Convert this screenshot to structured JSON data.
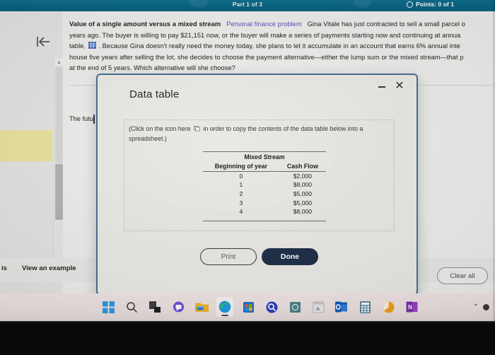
{
  "header": {
    "part_label": "Part 1 of 3",
    "points_text": "Points: 0 of 1",
    "points_icon": "circle-progress-icon",
    "bg_color": "#0a6585"
  },
  "problem": {
    "title": "Value of a single amount versus a mixed stream",
    "subtitle": "Personal finance problem",
    "body_1": "Gina Vitale has just contracted to sell a small parcel o",
    "body_2": "years ago.  The buyer is willing to pay $21,151 now, or the buyer will make  a series of payments starting now and continuing at annua",
    "body_3_pre": "table,",
    "body_3_post": ". Because Gina doesn't really need the money today, she plans to let it accumulate in an account that earns 6% annual inte",
    "body_4": "house five years after selling the lot, she decides to choose the payment alternative—either the lump sum or the mixed stream—that p",
    "body_5": "at the end of 5 years.  Which alternative will she choose?",
    "grid_icon": "data-table-grid-icon",
    "future_line": "The futu",
    "subtitle_color": "#5a4fc4"
  },
  "navigation": {
    "back_arrow_icon": "back-arrow-icon",
    "scrollbar_up_icon": "caret-up-icon",
    "scrollbar_down_icon": "caret-down-icon"
  },
  "action_bar": {
    "is_text": "is",
    "view_example_label": "View an example",
    "clear_all_label": "Clear all"
  },
  "dialog": {
    "title": "Data table",
    "minimize_icon": "minimize-icon",
    "close_icon": "close-icon",
    "hint_pre": "(Click on the icon here",
    "hint_post": "in order to copy the contents of the data table below into a spreadsheet.)",
    "copy_icon": "copy-to-spreadsheet-icon",
    "print_label": "Print",
    "done_label": "Done",
    "border_color": "#4b6f91",
    "done_bg": "#22304a"
  },
  "data_table": {
    "span_header": "Mixed Stream",
    "columns": [
      "Beginning of year",
      "Cash Flow"
    ],
    "rows": [
      [
        "0",
        "$2,000"
      ],
      [
        "1",
        "$8,000"
      ],
      [
        "2",
        "$5,000"
      ],
      [
        "3",
        "$5,000"
      ],
      [
        "4",
        "$8,000"
      ]
    ]
  },
  "taskbar": {
    "items": [
      {
        "name": "start-button-icon",
        "label": "Start"
      },
      {
        "name": "search-icon",
        "label": "Search"
      },
      {
        "name": "task-view-icon",
        "label": "Task View"
      },
      {
        "name": "chat-icon",
        "label": "Chat"
      },
      {
        "name": "file-explorer-icon",
        "label": "File Explorer"
      },
      {
        "name": "microsoft-edge-icon",
        "label": "Microsoft Edge"
      },
      {
        "name": "microsoft-store-icon",
        "label": "Microsoft Store"
      },
      {
        "name": "search-blue-icon",
        "label": "Search"
      },
      {
        "name": "teal-app-icon",
        "label": "App"
      },
      {
        "name": "window-app-icon",
        "label": "App"
      },
      {
        "name": "outlook-icon",
        "label": "Outlook"
      },
      {
        "name": "calculator-icon",
        "label": "Calculator"
      },
      {
        "name": "orange-circle-icon",
        "label": "App"
      },
      {
        "name": "onenote-icon",
        "label": "OneNote"
      }
    ],
    "chevron_icon": "chevron-up-icon",
    "tray_dot_icon": "tray-dot-icon"
  }
}
